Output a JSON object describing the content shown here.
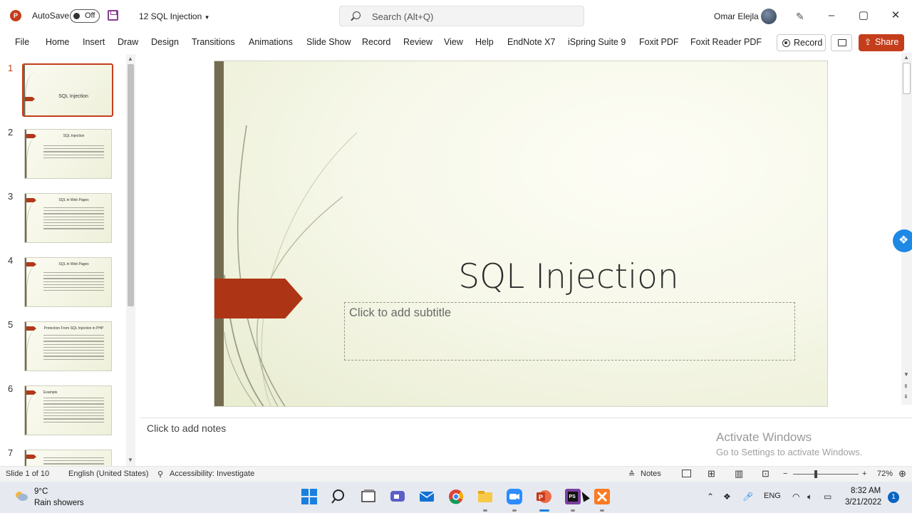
{
  "titlebar": {
    "app_logo": "P",
    "autosave_label": "AutoSave",
    "autosave_state": "Off",
    "doc_title": "12 SQL Injection",
    "search_placeholder": "Search (Alt+Q)",
    "user_name": "Omar Elejla",
    "minimize": "–",
    "maximize": "▢",
    "close": "✕"
  },
  "ribbon": {
    "tabs": [
      "File",
      "Home",
      "Insert",
      "Draw",
      "Design",
      "Transitions",
      "Animations",
      "Slide Show",
      "Record",
      "Review",
      "View",
      "Help",
      "EndNote X7",
      "iSpring Suite 9",
      "Foxit PDF",
      "Foxit Reader PDF"
    ],
    "record_label": "Record",
    "share_label": "Share"
  },
  "thumbnails": [
    {
      "num": "1",
      "title": "SQL Injection"
    },
    {
      "num": "2",
      "title": "SQL Injection"
    },
    {
      "num": "3",
      "title": "SQL in Web Pages"
    },
    {
      "num": "4",
      "title": "SQL in Web Pages"
    },
    {
      "num": "5",
      "title": "Protection From SQL Injection in PHP"
    },
    {
      "num": "6",
      "title": "Example"
    },
    {
      "num": "7",
      "title": ""
    }
  ],
  "slide": {
    "title": "SQL Injection",
    "subtitle_placeholder": "Click to add subtitle"
  },
  "notes_placeholder": "Click to add notes",
  "watermark": {
    "line1": "Activate Windows",
    "line2": "Go to Settings to activate Windows."
  },
  "statusbar": {
    "slide_info": "Slide 1 of 10",
    "language": "English (United States)",
    "accessibility": "Accessibility: Investigate",
    "notes_label": "Notes",
    "zoom_minus": "−",
    "zoom_plus": "+",
    "zoom": "72%"
  },
  "taskbar": {
    "temperature": "9°C",
    "condition": "Rain showers",
    "language": "ENG",
    "time": "8:32 AM",
    "date": "3/21/2022",
    "notifications": "1"
  },
  "colors": {
    "accent": "#c43e1c",
    "slide_arrow": "#ad3515",
    "slide_bar": "#746c50"
  }
}
